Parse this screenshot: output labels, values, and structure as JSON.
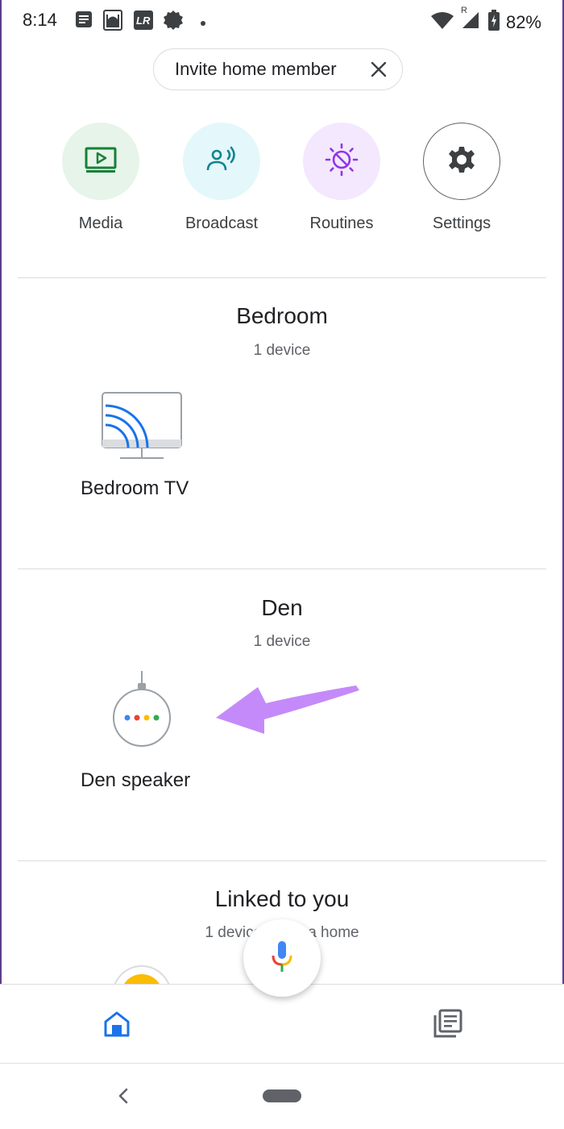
{
  "status_bar": {
    "time": "8:14",
    "battery": "82%",
    "icons": [
      "notes-icon",
      "mosque-icon",
      "lr-icon",
      "badge-icon",
      "dot-icon",
      "wifi-icon",
      "signal-icon",
      "battery-icon"
    ],
    "lr_text": "LR",
    "roaming": "R"
  },
  "invite_chip": {
    "label": "Invite home member"
  },
  "actions": [
    {
      "label": "Media",
      "icon": "media-icon",
      "bg": "#e6f4ea",
      "fg": "#188038"
    },
    {
      "label": "Broadcast",
      "icon": "broadcast-icon",
      "bg": "#e4f7fb",
      "fg": "#12848f"
    },
    {
      "label": "Routines",
      "icon": "routines-icon",
      "bg": "#f3e8fd",
      "fg": "#9334e6"
    },
    {
      "label": "Settings",
      "icon": "gear-icon",
      "bg": "#ffffff",
      "fg": "#3c4043"
    }
  ],
  "rooms": [
    {
      "name": "Bedroom",
      "count": "1 device",
      "devices": [
        {
          "label": "Bedroom TV",
          "icon": "cast-tv-icon"
        }
      ]
    },
    {
      "name": "Den",
      "count": "1 device",
      "devices": [
        {
          "label": "Den speaker",
          "icon": "google-home-mini-icon"
        }
      ]
    }
  ],
  "linked": {
    "title": "Linked to you",
    "subtitle": "1 device not in a home"
  },
  "colors": {
    "accent_blue": "#1a73e8",
    "arrow": "#c58af9",
    "google_blue": "#4285f4",
    "google_red": "#ea4335",
    "google_yellow": "#fbbc04",
    "google_green": "#34a853"
  }
}
